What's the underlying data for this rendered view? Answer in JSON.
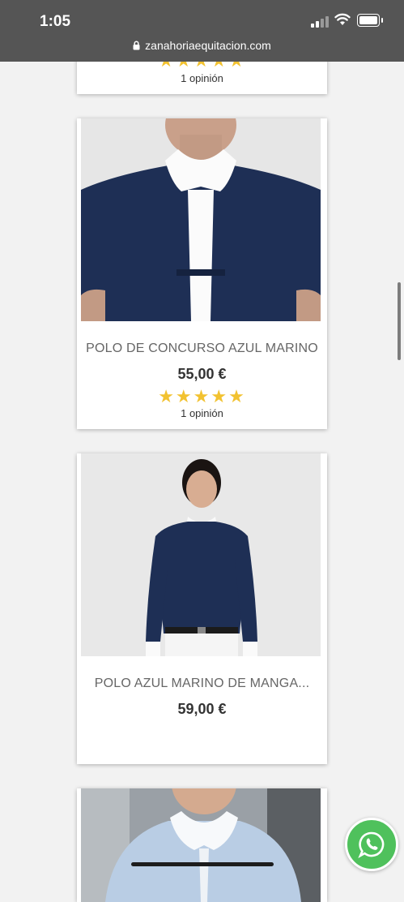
{
  "status_bar": {
    "time": "1:05"
  },
  "browser": {
    "url": "zanahoriaequitacion.com"
  },
  "products": [
    {
      "title": "",
      "price": "",
      "stars": "★★★★★",
      "rating": 5,
      "reviews": "1 opinión"
    },
    {
      "title": "POLO DE CONCURSO AZUL MARINO",
      "price": "55,00 €",
      "stars": "★★★★★",
      "rating": 5,
      "reviews": "1 opinión"
    },
    {
      "title": "POLO AZUL MARINO DE MANGA...",
      "price": "59,00 €"
    },
    {
      "title": "",
      "price": ""
    }
  ],
  "colors": {
    "star": "#f2c230",
    "status_bar": "#555555",
    "whatsapp": "#4fc15c",
    "navy": "#1e2f55"
  },
  "icons": [
    "lock-icon",
    "signal-icon",
    "wifi-icon",
    "battery-icon",
    "whatsapp-icon"
  ]
}
